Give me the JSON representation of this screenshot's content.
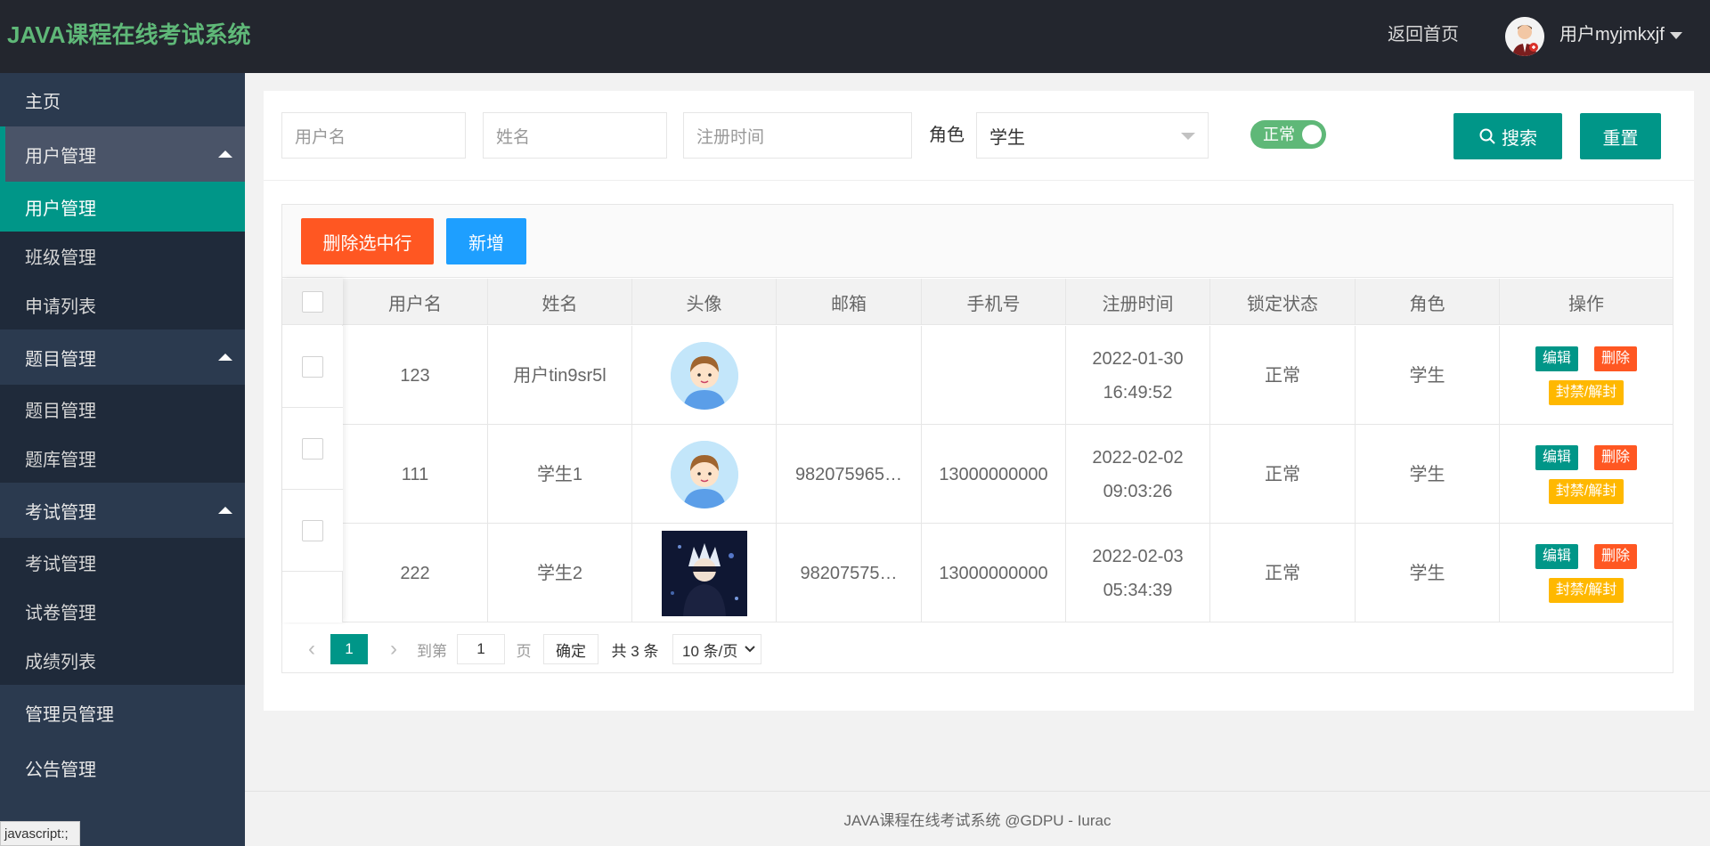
{
  "header": {
    "logo": "JAVA课程在线考试系统",
    "home_link": "返回首页",
    "user_name": "用户myjmkxjf"
  },
  "sidebar": {
    "items": [
      {
        "label": "主页"
      },
      {
        "label": "用户管理"
      },
      {
        "label": "用户管理"
      },
      {
        "label": "班级管理"
      },
      {
        "label": "申请列表"
      },
      {
        "label": "题目管理"
      },
      {
        "label": "题目管理"
      },
      {
        "label": "题库管理"
      },
      {
        "label": "考试管理"
      },
      {
        "label": "考试管理"
      },
      {
        "label": "试卷管理"
      },
      {
        "label": "成绩列表"
      },
      {
        "label": "管理员管理"
      },
      {
        "label": "公告管理"
      }
    ]
  },
  "search": {
    "username_placeholder": "用户名",
    "name_placeholder": "姓名",
    "regtime_placeholder": "注册时间",
    "role_label": "角色",
    "role_value": "学生",
    "status_switch": "正常",
    "search_button": "搜索",
    "reset_button": "重置"
  },
  "toolbar": {
    "delete_selected": "删除选中行",
    "add": "新增"
  },
  "table": {
    "columns": [
      "用户名",
      "姓名",
      "头像",
      "邮箱",
      "手机号",
      "注册时间",
      "锁定状态",
      "角色",
      "操作"
    ],
    "rows": [
      {
        "username": "123",
        "name": "用户tin9sr5l",
        "email": "",
        "phone": "",
        "reg_date": "2022-01-30",
        "reg_time": "16:49:52",
        "lock": "正常",
        "role": "学生"
      },
      {
        "username": "111",
        "name": "学生1",
        "email": "982075965…",
        "phone": "13000000000",
        "reg_date": "2022-02-02",
        "reg_time": "09:03:26",
        "lock": "正常",
        "role": "学生"
      },
      {
        "username": "222",
        "name": "学生2",
        "email": "98207575…",
        "phone": "13000000000",
        "reg_date": "2022-02-03",
        "reg_time": "05:34:39",
        "lock": "正常",
        "role": "学生"
      }
    ],
    "actions": {
      "edit": "编辑",
      "delete": "删除",
      "ban": "封禁/解封"
    }
  },
  "pager": {
    "current": "1",
    "goto_label": "到第",
    "goto_value": "1",
    "page_unit": "页",
    "confirm": "确定",
    "total": "共 3 条",
    "page_size": "10 条/页"
  },
  "footer": {
    "text": "JAVA课程在线考试系统 @GDPU - Iurac"
  },
  "status_bar": {
    "text": "javascript:;"
  },
  "colors": {
    "header_bg": "#23262e",
    "sidebar_bg": "#2b3a4f",
    "accent": "#009688",
    "danger": "#ff5722",
    "info": "#1e9fff",
    "warn": "#ffb800",
    "logo": "#5fb878"
  }
}
